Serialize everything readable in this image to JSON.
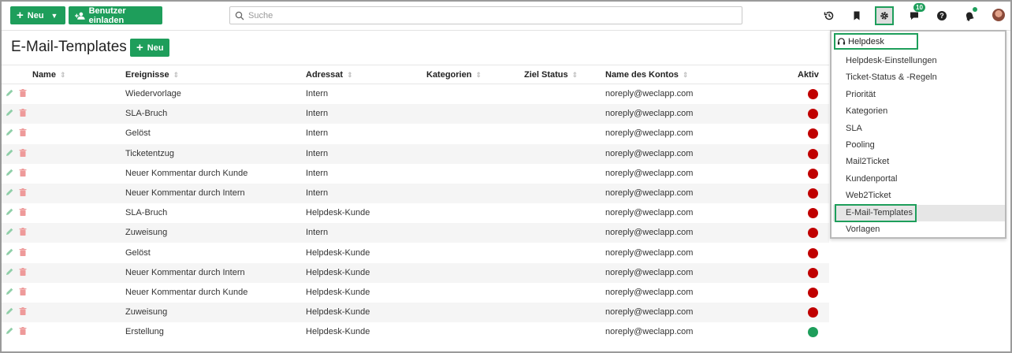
{
  "toolbar": {
    "new_label": "Neu",
    "invite_label": "Benutzer einladen",
    "search_placeholder": "Suche",
    "chat_badge": "10"
  },
  "page": {
    "title": "E-Mail-Templates",
    "new_label": "Neu"
  },
  "table": {
    "columns": [
      "Name",
      "Ereignisse",
      "Adressat",
      "Kategorien",
      "Ziel Status",
      "Name des Kontos",
      "Aktiv"
    ],
    "rows": [
      {
        "event": "Wiedervorlage",
        "recipient": "Intern",
        "account": "noreply@weclapp.com",
        "active": false
      },
      {
        "event": "SLA-Bruch",
        "recipient": "Intern",
        "account": "noreply@weclapp.com",
        "active": false
      },
      {
        "event": "Gelöst",
        "recipient": "Intern",
        "account": "noreply@weclapp.com",
        "active": false
      },
      {
        "event": "Ticketentzug",
        "recipient": "Intern",
        "account": "noreply@weclapp.com",
        "active": false
      },
      {
        "event": "Neuer Kommentar durch Kunde",
        "recipient": "Intern",
        "account": "noreply@weclapp.com",
        "active": false
      },
      {
        "event": "Neuer Kommentar durch Intern",
        "recipient": "Intern",
        "account": "noreply@weclapp.com",
        "active": false
      },
      {
        "event": "SLA-Bruch",
        "recipient": "Helpdesk-Kunde",
        "account": "noreply@weclapp.com",
        "active": false
      },
      {
        "event": "Zuweisung",
        "recipient": "Intern",
        "account": "noreply@weclapp.com",
        "active": false
      },
      {
        "event": "Gelöst",
        "recipient": "Helpdesk-Kunde",
        "account": "noreply@weclapp.com",
        "active": false
      },
      {
        "event": "Neuer Kommentar durch Intern",
        "recipient": "Helpdesk-Kunde",
        "account": "noreply@weclapp.com",
        "active": false
      },
      {
        "event": "Neuer Kommentar durch Kunde",
        "recipient": "Helpdesk-Kunde",
        "account": "noreply@weclapp.com",
        "active": false
      },
      {
        "event": "Zuweisung",
        "recipient": "Helpdesk-Kunde",
        "account": "noreply@weclapp.com",
        "active": false
      },
      {
        "event": "Erstellung",
        "recipient": "Helpdesk-Kunde",
        "account": "noreply@weclapp.com",
        "active": true
      }
    ]
  },
  "dropdown": {
    "header": "Helpdesk",
    "items": [
      "Helpdesk-Einstellungen",
      "Ticket-Status & -Regeln",
      "Priorität",
      "Kategorien",
      "SLA",
      "Pooling",
      "Mail2Ticket",
      "Kundenportal",
      "Web2Ticket",
      "E-Mail-Templates",
      "Vorlagen"
    ],
    "active_item": "E-Mail-Templates"
  },
  "colors": {
    "accent": "#1e9e5b",
    "inactive": "#c00000",
    "active": "#1e9e5b"
  }
}
